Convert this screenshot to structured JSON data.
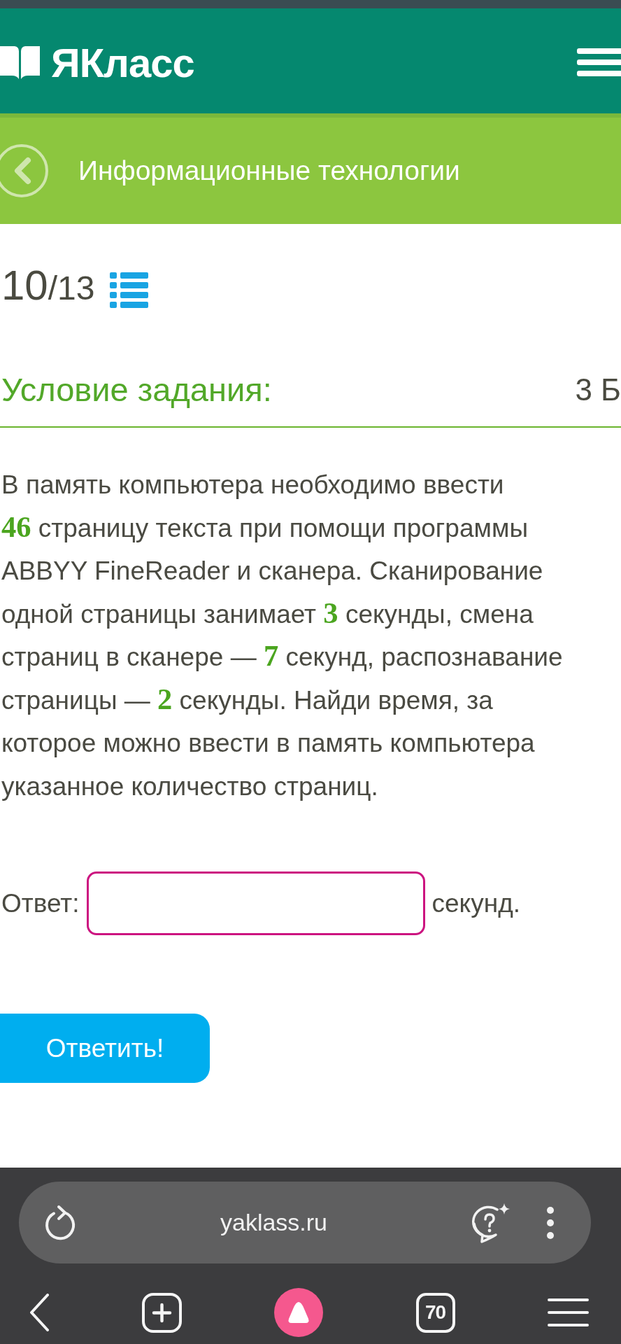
{
  "header": {
    "logo": "ЯКласс"
  },
  "subject_bar": {
    "title": "Информационные технологии"
  },
  "task": {
    "current": "10",
    "total": "/13"
  },
  "condition": {
    "heading": "Условие задания:",
    "points": "3 Б"
  },
  "problem_text": "В память компьютера необходимо ввести\n**46** страницу текста при помощи программы\nABBYY FineReader и сканера. Сканирование\nодной страницы занимает **3** секунды, смена\nстраниц в сканере — **7** секунд, распознавание\nстраницы — **2** секунды. Найди время, за\nкоторое можно ввести в память компьютера\nуказанное количество страниц.",
  "answer": {
    "label": "Ответ:",
    "unit": "секунд."
  },
  "submit_button": "Ответить!",
  "browser": {
    "url": "yaklass.ru",
    "tab_count": "70"
  }
}
